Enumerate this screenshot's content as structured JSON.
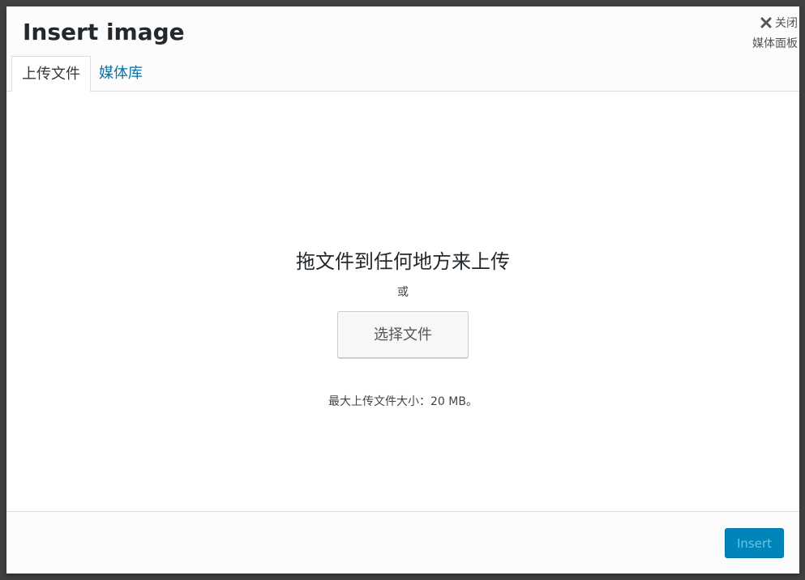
{
  "modal": {
    "title": "Insert image",
    "close_label": "关闭",
    "panel_label": "媒体面板"
  },
  "tabs": [
    {
      "label": "上传文件",
      "active": true
    },
    {
      "label": "媒体库",
      "active": false
    }
  ],
  "uploader": {
    "drop_text": "拖文件到任何地方来上传",
    "or_text": "或",
    "select_button": "选择文件",
    "max_size": "最大上传文件大小：20 MB。"
  },
  "footer": {
    "insert_button": "Insert",
    "insert_disabled": true
  },
  "colors": {
    "accent": "#0085ba",
    "link": "#0073aa"
  }
}
